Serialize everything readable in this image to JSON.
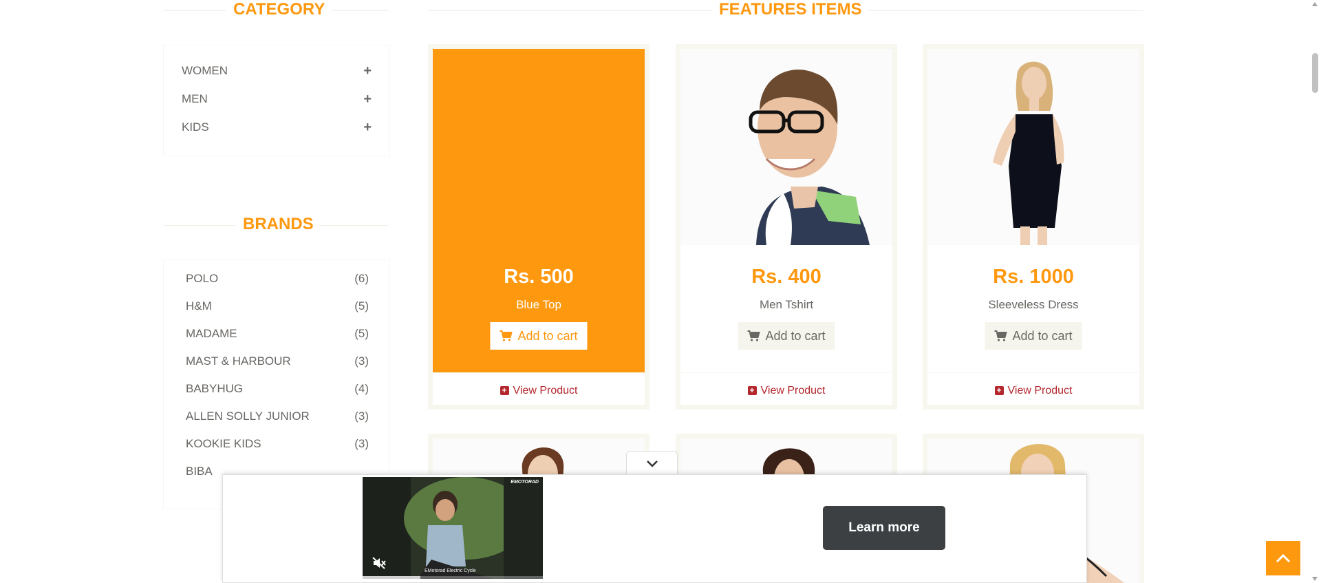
{
  "category": {
    "title": "CATEGORY",
    "items": [
      {
        "label": "WOMEN",
        "icon": "plus-icon"
      },
      {
        "label": "MEN",
        "icon": "plus-icon"
      },
      {
        "label": "KIDS",
        "icon": "plus-icon"
      }
    ]
  },
  "brands": {
    "title": "BRANDS",
    "items": [
      {
        "label": "POLO",
        "count": "(6)"
      },
      {
        "label": "H&M",
        "count": "(5)"
      },
      {
        "label": "MADAME",
        "count": "(5)"
      },
      {
        "label": "MAST & HARBOUR",
        "count": "(3)"
      },
      {
        "label": "BABYHUG",
        "count": "(4)"
      },
      {
        "label": "ALLEN SOLLY JUNIOR",
        "count": "(3)"
      },
      {
        "label": "KOOKIE KIDS",
        "count": "(3)"
      },
      {
        "label": "BIBA",
        "count": ""
      }
    ]
  },
  "features": {
    "title": "FEATURES ITEMS",
    "products": [
      {
        "price": "Rs. 500",
        "name": "Blue Top",
        "cart_label": "Add to cart",
        "view_label": "View Product"
      },
      {
        "price": "Rs. 400",
        "name": "Men Tshirt",
        "cart_label": "Add to cart",
        "view_label": "View Product"
      },
      {
        "price": "Rs. 1000",
        "name": "Sleeveless Dress",
        "cart_label": "Add to cart",
        "view_label": "View Product"
      }
    ]
  },
  "ad": {
    "learn_more": "Learn more",
    "video_brand": "EMOTORAD",
    "video_caption": "EMotorad Electric Cycle"
  },
  "colors": {
    "accent": "#FE980F",
    "link": "#B3272D",
    "text": "#696763"
  }
}
